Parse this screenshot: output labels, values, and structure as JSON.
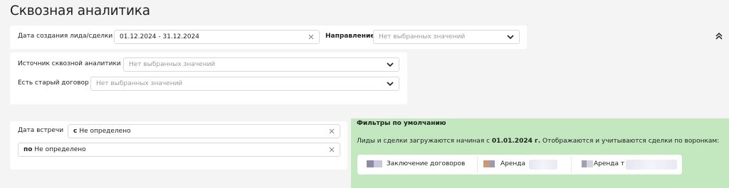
{
  "page": {
    "title": "Сквозная аналитика"
  },
  "filters": {
    "created_date": {
      "label": "Дата создания лида/сделки",
      "value": "01.12.2024 - 31.12.2024"
    },
    "direction": {
      "label": "Направление",
      "placeholder": "Нет выбранных значений"
    },
    "source": {
      "label": "Источник сквозной аналитики",
      "placeholder": "Нет выбранных значений"
    },
    "old_contract": {
      "label": "Есть старый договор",
      "placeholder": "Нет выбранных значений"
    },
    "meeting_date": {
      "label": "Дата встречи",
      "from_prefix": "с",
      "from_value": "Не определено",
      "to_prefix": "по",
      "to_value": "Не определено"
    }
  },
  "defaults_panel": {
    "title": "Фильтры по умолчанию",
    "text_before": "Лиды и сделки загружаются начиная с",
    "date": "01.01.2024 г.",
    "text_after": "Отображаются и учитываются сделки по воронкам:",
    "funnels": [
      {
        "name": "Заключение договоров",
        "color_a": "#8d8aa6",
        "color_b": "#c9c7dd"
      },
      {
        "name": "Аренда",
        "color_a": "#c89a78",
        "color_b": "#9d9ab8"
      },
      {
        "name": "Аренда т",
        "color_a": "#a19fb2",
        "color_b": "#d6d3e4"
      }
    ]
  },
  "colors": {
    "panel_background": "#ffffff",
    "defaults_background": "#c3e8c0",
    "page_background": "#f4f4f5"
  },
  "icons": {
    "clear": "close-icon",
    "dropdown": "chevron-down-icon",
    "collapse": "double-chevron-up-icon"
  }
}
